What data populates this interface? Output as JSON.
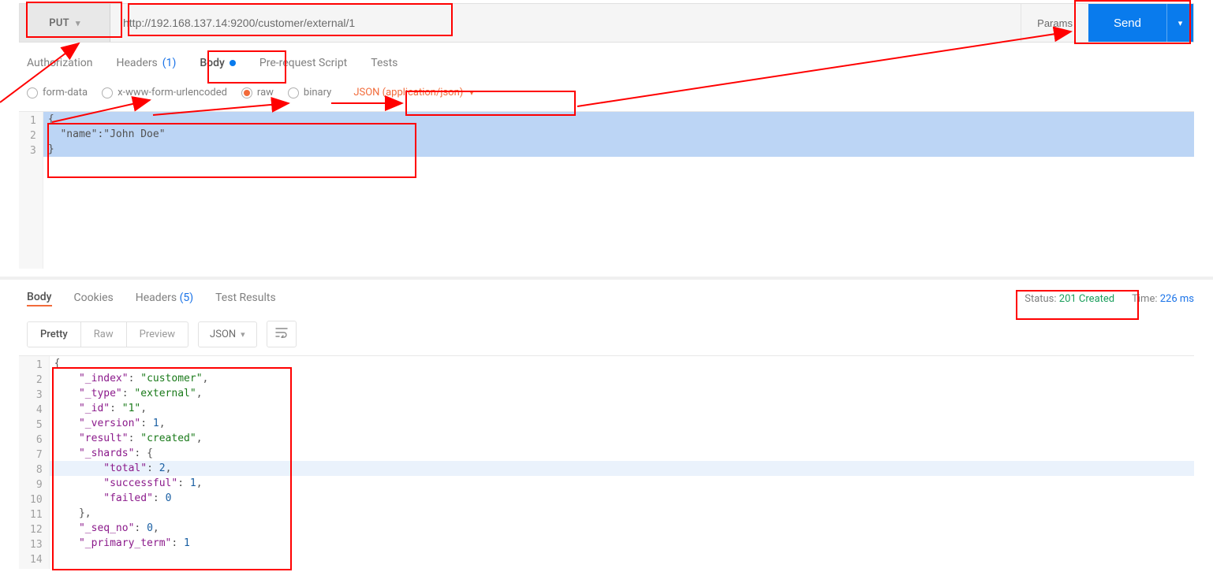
{
  "request": {
    "method": "PUT",
    "url": "http://192.168.137.14:9200/customer/external/1",
    "params_label": "Params",
    "send_label": "Send"
  },
  "req_tabs": {
    "auth": "Authorization",
    "headers": "Headers",
    "headers_count": "(1)",
    "body": "Body",
    "prerequest": "Pre-request Script",
    "tests": "Tests"
  },
  "body_types": {
    "formdata": "form-data",
    "urlencoded": "x-www-form-urlencoded",
    "raw": "raw",
    "binary": "binary",
    "content_type": "JSON (application/json)"
  },
  "request_body": {
    "lines_nums": [
      "1",
      "2",
      "3"
    ],
    "line1": "{",
    "line2": "  \"name\":\"John Doe\"",
    "line3": "}"
  },
  "response_tabs": {
    "body": "Body",
    "cookies": "Cookies",
    "headers": "Headers",
    "headers_count": "(5)",
    "test_results": "Test Results"
  },
  "response_meta": {
    "status_label": "Status:",
    "status_value": "201 Created",
    "time_label": "Time:",
    "time_value": "226 ms"
  },
  "view_modes": {
    "pretty": "Pretty",
    "raw": "Raw",
    "preview": "Preview",
    "lang": "JSON"
  },
  "response_body": {
    "nums": [
      "1",
      "2",
      "3",
      "4",
      "5",
      "6",
      "7",
      "8",
      "9",
      "10",
      "11",
      "12",
      "13",
      "14"
    ],
    "L1": "{",
    "L2_k": "\"_index\"",
    "L2_v": "\"customer\"",
    "L3_k": "\"_type\"",
    "L3_v": "\"external\"",
    "L4_k": "\"_id\"",
    "L4_v": "\"1\"",
    "L5_k": "\"_version\"",
    "L5_v": "1",
    "L6_k": "\"result\"",
    "L6_v": "\"created\"",
    "L7_k": "\"_shards\"",
    "L7_v": "{",
    "L8_k": "\"total\"",
    "L8_v": "2",
    "L9_k": "\"successful\"",
    "L9_v": "1",
    "L10_k": "\"failed\"",
    "L10_v": "0",
    "L11": "},",
    "L12_k": "\"_seq_no\"",
    "L12_v": "0",
    "L13_k": "\"_primary_term\"",
    "L13_v": "1"
  }
}
